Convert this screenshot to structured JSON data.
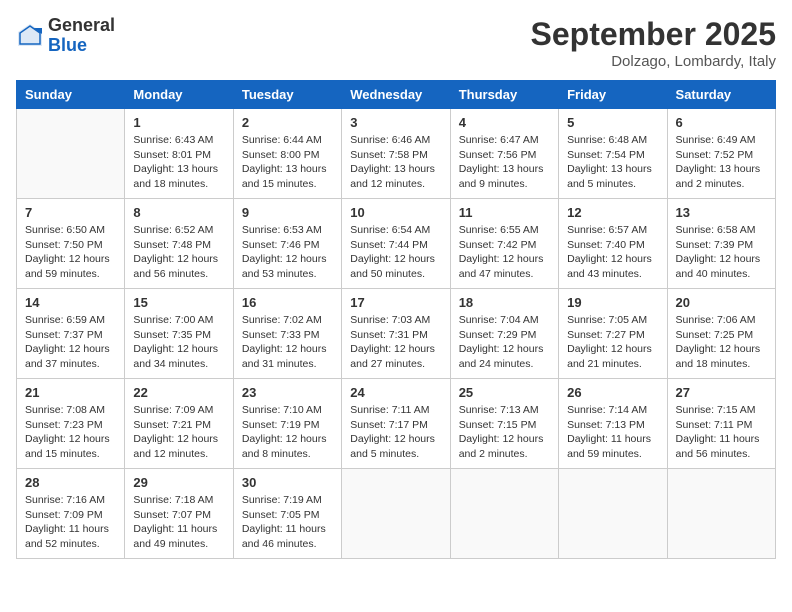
{
  "header": {
    "logo": {
      "general": "General",
      "blue": "Blue"
    },
    "title": "September 2025",
    "location": "Dolzago, Lombardy, Italy"
  },
  "days_of_week": [
    "Sunday",
    "Monday",
    "Tuesday",
    "Wednesday",
    "Thursday",
    "Friday",
    "Saturday"
  ],
  "weeks": [
    [
      {
        "day": "",
        "info": ""
      },
      {
        "day": "1",
        "info": "Sunrise: 6:43 AM\nSunset: 8:01 PM\nDaylight: 13 hours\nand 18 minutes."
      },
      {
        "day": "2",
        "info": "Sunrise: 6:44 AM\nSunset: 8:00 PM\nDaylight: 13 hours\nand 15 minutes."
      },
      {
        "day": "3",
        "info": "Sunrise: 6:46 AM\nSunset: 7:58 PM\nDaylight: 13 hours\nand 12 minutes."
      },
      {
        "day": "4",
        "info": "Sunrise: 6:47 AM\nSunset: 7:56 PM\nDaylight: 13 hours\nand 9 minutes."
      },
      {
        "day": "5",
        "info": "Sunrise: 6:48 AM\nSunset: 7:54 PM\nDaylight: 13 hours\nand 5 minutes."
      },
      {
        "day": "6",
        "info": "Sunrise: 6:49 AM\nSunset: 7:52 PM\nDaylight: 13 hours\nand 2 minutes."
      }
    ],
    [
      {
        "day": "7",
        "info": "Sunrise: 6:50 AM\nSunset: 7:50 PM\nDaylight: 12 hours\nand 59 minutes."
      },
      {
        "day": "8",
        "info": "Sunrise: 6:52 AM\nSunset: 7:48 PM\nDaylight: 12 hours\nand 56 minutes."
      },
      {
        "day": "9",
        "info": "Sunrise: 6:53 AM\nSunset: 7:46 PM\nDaylight: 12 hours\nand 53 minutes."
      },
      {
        "day": "10",
        "info": "Sunrise: 6:54 AM\nSunset: 7:44 PM\nDaylight: 12 hours\nand 50 minutes."
      },
      {
        "day": "11",
        "info": "Sunrise: 6:55 AM\nSunset: 7:42 PM\nDaylight: 12 hours\nand 47 minutes."
      },
      {
        "day": "12",
        "info": "Sunrise: 6:57 AM\nSunset: 7:40 PM\nDaylight: 12 hours\nand 43 minutes."
      },
      {
        "day": "13",
        "info": "Sunrise: 6:58 AM\nSunset: 7:39 PM\nDaylight: 12 hours\nand 40 minutes."
      }
    ],
    [
      {
        "day": "14",
        "info": "Sunrise: 6:59 AM\nSunset: 7:37 PM\nDaylight: 12 hours\nand 37 minutes."
      },
      {
        "day": "15",
        "info": "Sunrise: 7:00 AM\nSunset: 7:35 PM\nDaylight: 12 hours\nand 34 minutes."
      },
      {
        "day": "16",
        "info": "Sunrise: 7:02 AM\nSunset: 7:33 PM\nDaylight: 12 hours\nand 31 minutes."
      },
      {
        "day": "17",
        "info": "Sunrise: 7:03 AM\nSunset: 7:31 PM\nDaylight: 12 hours\nand 27 minutes."
      },
      {
        "day": "18",
        "info": "Sunrise: 7:04 AM\nSunset: 7:29 PM\nDaylight: 12 hours\nand 24 minutes."
      },
      {
        "day": "19",
        "info": "Sunrise: 7:05 AM\nSunset: 7:27 PM\nDaylight: 12 hours\nand 21 minutes."
      },
      {
        "day": "20",
        "info": "Sunrise: 7:06 AM\nSunset: 7:25 PM\nDaylight: 12 hours\nand 18 minutes."
      }
    ],
    [
      {
        "day": "21",
        "info": "Sunrise: 7:08 AM\nSunset: 7:23 PM\nDaylight: 12 hours\nand 15 minutes."
      },
      {
        "day": "22",
        "info": "Sunrise: 7:09 AM\nSunset: 7:21 PM\nDaylight: 12 hours\nand 12 minutes."
      },
      {
        "day": "23",
        "info": "Sunrise: 7:10 AM\nSunset: 7:19 PM\nDaylight: 12 hours\nand 8 minutes."
      },
      {
        "day": "24",
        "info": "Sunrise: 7:11 AM\nSunset: 7:17 PM\nDaylight: 12 hours\nand 5 minutes."
      },
      {
        "day": "25",
        "info": "Sunrise: 7:13 AM\nSunset: 7:15 PM\nDaylight: 12 hours\nand 2 minutes."
      },
      {
        "day": "26",
        "info": "Sunrise: 7:14 AM\nSunset: 7:13 PM\nDaylight: 11 hours\nand 59 minutes."
      },
      {
        "day": "27",
        "info": "Sunrise: 7:15 AM\nSunset: 7:11 PM\nDaylight: 11 hours\nand 56 minutes."
      }
    ],
    [
      {
        "day": "28",
        "info": "Sunrise: 7:16 AM\nSunset: 7:09 PM\nDaylight: 11 hours\nand 52 minutes."
      },
      {
        "day": "29",
        "info": "Sunrise: 7:18 AM\nSunset: 7:07 PM\nDaylight: 11 hours\nand 49 minutes."
      },
      {
        "day": "30",
        "info": "Sunrise: 7:19 AM\nSunset: 7:05 PM\nDaylight: 11 hours\nand 46 minutes."
      },
      {
        "day": "",
        "info": ""
      },
      {
        "day": "",
        "info": ""
      },
      {
        "day": "",
        "info": ""
      },
      {
        "day": "",
        "info": ""
      }
    ]
  ]
}
